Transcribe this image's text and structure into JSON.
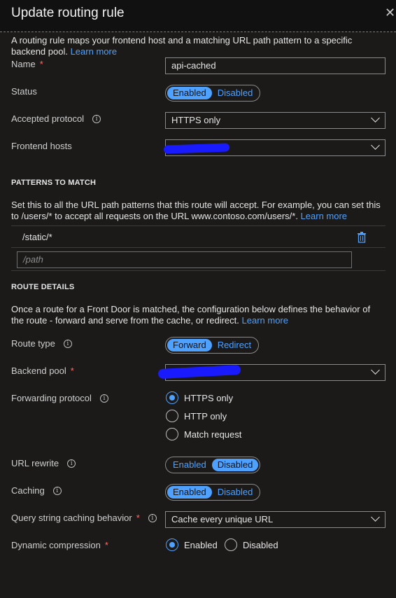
{
  "header": {
    "title": "Update routing rule",
    "close_icon": "close-icon"
  },
  "intro": {
    "text": "A routing rule maps your frontend host and a matching URL path pattern to a specific backend pool.",
    "link": "Learn more"
  },
  "name": {
    "label": "Name",
    "required": "*",
    "value": "api-cached"
  },
  "status": {
    "label": "Status",
    "options": [
      "Enabled",
      "Disabled"
    ],
    "selected": "Enabled"
  },
  "accepted_protocol": {
    "label": "Accepted protocol",
    "value": "HTTPS only"
  },
  "frontend_hosts": {
    "label": "Frontend hosts",
    "value": ""
  },
  "patterns": {
    "heading": "PATTERNS TO MATCH",
    "desc": "Set this to all the URL path patterns that this route will accept. For example, you can set this to /users/* to accept all requests on the URL www.contoso.com/users/*.",
    "link": "Learn more",
    "items": [
      "/static/*"
    ],
    "placeholder": "/path"
  },
  "route_details": {
    "heading": "ROUTE DETAILS",
    "desc": "Once a route for a Front Door is matched, the configuration below defines the behavior of the route - forward and serve from the cache, or redirect.",
    "link": "Learn more"
  },
  "route_type": {
    "label": "Route type",
    "options": [
      "Forward",
      "Redirect"
    ],
    "selected": "Forward"
  },
  "backend_pool": {
    "label": "Backend pool",
    "required": "*",
    "value": ""
  },
  "forwarding_protocol": {
    "label": "Forwarding protocol",
    "options": [
      "HTTPS only",
      "HTTP only",
      "Match request"
    ],
    "selected": "HTTPS only"
  },
  "url_rewrite": {
    "label": "URL rewrite",
    "options": [
      "Enabled",
      "Disabled"
    ],
    "selected": "Disabled"
  },
  "caching": {
    "label": "Caching",
    "options": [
      "Enabled",
      "Disabled"
    ],
    "selected": "Enabled"
  },
  "query_string": {
    "label": "Query string caching behavior",
    "required": "*",
    "value": "Cache every unique URL"
  },
  "dynamic_compression": {
    "label": "Dynamic compression",
    "required": "*",
    "options": [
      "Enabled",
      "Disabled"
    ],
    "selected": "Enabled"
  },
  "colors": {
    "accent": "#4ea1ff",
    "background": "#1b1a19",
    "required": "#ff6b6b",
    "redaction": "#1a1aff"
  }
}
